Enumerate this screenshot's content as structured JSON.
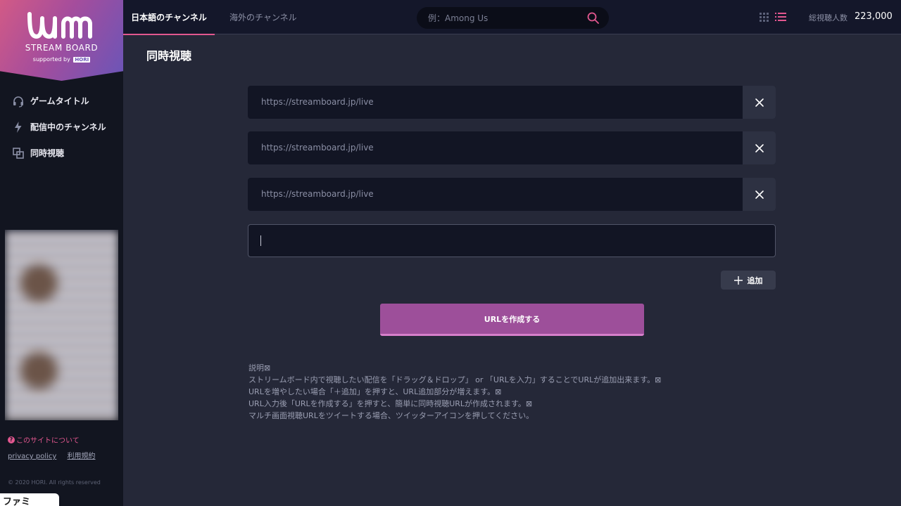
{
  "brand": {
    "logo_text": "STREAM BOARD",
    "supported_by": "supported by",
    "sponsor": "HORI",
    "accent_color": "#e2578f",
    "gradient_colors": [
      "#d25a86",
      "#a54d9c",
      "#6a55b8"
    ]
  },
  "sidebar": {
    "items": [
      {
        "label": "ゲームタイトル",
        "icon": "headset-icon"
      },
      {
        "label": "配信中のチャンネル",
        "icon": "lightning-icon"
      },
      {
        "label": "同時視聴",
        "icon": "multi-view-icon"
      }
    ],
    "about_label": "このサイトについて",
    "privacy_label": "privacy policy",
    "terms_label": "利用規約",
    "copyright": "© 2020 HORI. All rights reserved"
  },
  "header": {
    "tabs": [
      {
        "label": "日本語のチャンネル",
        "active": true
      },
      {
        "label": "海外のチャンネル",
        "active": false
      }
    ],
    "search_placeholder": "例：Among Us",
    "viewers_label": "総視聴人数",
    "viewers_count": "223,000"
  },
  "main": {
    "title": "同時視聴",
    "url_rows": [
      {
        "url": "https://streamboard.jp/live"
      },
      {
        "url": "https://streamboard.jp/live"
      },
      {
        "url": "https://streamboard.jp/live"
      }
    ],
    "add_label": "追加",
    "create_label": "URLを作成する",
    "description": [
      "説明⊠",
      "ストリームボード内で視聴したい配信を「ドラッグ＆ドロップ」 or 「URLを入力」することでURLが追加出来ます。⊠",
      "URLを増やしたい場合「＋追加」を押すと、URL追加部分が増えます。⊠",
      "URL入力後「URLを作成する」を押すと、簡単に同時視聴URLが作成されます。⊠",
      "マルチ画面視聴URLをツイートする場合、ツイッターアイコンを押してください。"
    ]
  },
  "watermark": "ファミ通.com"
}
